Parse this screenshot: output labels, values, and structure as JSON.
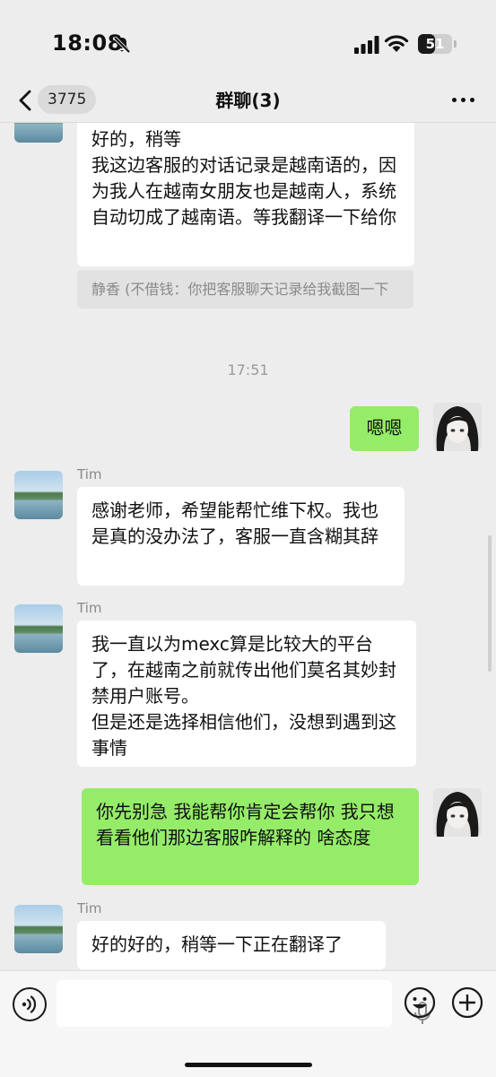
{
  "status_bar": {
    "time": "18:08",
    "battery": "51",
    "battery_level": 0.51
  },
  "nav": {
    "unread_count": "3775",
    "title": "群聊(3)"
  },
  "messages": [
    {
      "direction": "incoming",
      "text": "好的，稍等\n我这边客服的对话记录是越南语的，因为我人在越南女朋友也是越南人，系统自动切成了越南语。等我翻译一下给你",
      "quote": "静香 (不借钱：你把客服聊天记录给我截图一下"
    },
    {
      "type": "timestamp",
      "text": "17:51"
    },
    {
      "direction": "outgoing",
      "text": "嗯嗯"
    },
    {
      "direction": "incoming",
      "sender": "Tim",
      "text": "感谢老师，希望能帮忙维下权。我也是真的没办法了，客服一直含糊其辞"
    },
    {
      "direction": "incoming",
      "sender": "Tim",
      "text": "我一直以为mexc算是比较大的平台了，在越南之前就传出他们莫名其妙封禁用户账号。\n但是还是选择相信他们，没想到遇到这事情"
    },
    {
      "direction": "outgoing",
      "text": "你先别急 我能帮你肯定会帮你 我只想看看他们那边客服咋解释的 啥态度"
    },
    {
      "direction": "incoming",
      "sender": "Tim",
      "text": "好的好的，稍等一下正在翻译了"
    }
  ],
  "icons": {
    "back": "chevron-left-icon",
    "more": "more-horizontal-icon",
    "voice": "voice-input-icon",
    "mic": "microphone-icon",
    "emoji": "emoji-icon",
    "plus": "plus-icon",
    "mute": "bell-slash-icon"
  },
  "colors": {
    "background": "#ededed",
    "outgoing_bubble": "#95ec69",
    "incoming_bubble": "#ffffff"
  }
}
